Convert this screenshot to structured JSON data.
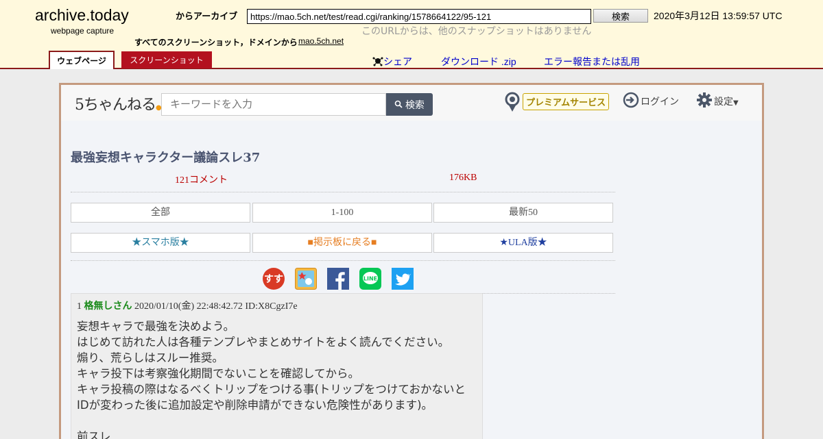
{
  "archive": {
    "brand_title": "archive.today",
    "brand_subtitle": "webpage capture",
    "archive_label": "からアーカイブ",
    "url_value": "https://mao.5ch.net/test/read.cgi/ranking/1578664122/95-121",
    "search_button": "検索",
    "capture_date": "2020年3月12日 13:59:57 UTC",
    "no_snapshots": "このURLからは、他のスナップショットはありません",
    "all_screenshots_label": "すべてのスクリーンショット，ドメインから",
    "domain_link": "mao.5ch.net",
    "tabs": [
      {
        "label": "ウェブページ",
        "active": true
      },
      {
        "label": "スクリーンショット",
        "active": false
      }
    ],
    "share_label": "シェア",
    "download_label": "ダウンロード .zip",
    "report_label": "エラー報告または乱用"
  },
  "site": {
    "logo_text": "5ちゃんねる",
    "keyword_placeholder": "キーワードを入力",
    "search_button": "検索",
    "premium_label": "プレミアムサービス",
    "login_label": "ログイン",
    "settings_label": "設定"
  },
  "thread": {
    "title": "最強妄想キャラクター議論スレ37",
    "comment_count": "121コメント",
    "size": "176KB",
    "nav_buttons": [
      "全部",
      "1-100",
      "最新50"
    ],
    "link_buttons": [
      "★スマホ版★",
      "■掲示板に戻る■",
      "★ULA版★"
    ]
  },
  "share_icons": [
    "sssp-icon",
    "bookmark-icon",
    "facebook-icon",
    "line-icon",
    "twitter-icon"
  ],
  "post": {
    "number": "1",
    "author": "格無しさん",
    "datetime": "2020/01/10(金) 22:48:42.72",
    "id": "ID:X8CgzI7e",
    "body": [
      "妄想キャラで最強を決めよう。",
      "はじめて訪れた人は各種テンプレやまとめサイトをよく読んでください。",
      "煽り、荒らしはスルー推奨。",
      "キャラ投下は考察強化期間でないことを確認してから。",
      "キャラ投稿の際はなるべくトリップをつける事(トリップをつけておかないと",
      "IDが変わった後に追加設定や削除申請ができない危険性があります)。",
      "",
      "前スレ"
    ]
  },
  "colors": {
    "archive_bg": "#fff9dd",
    "archive_accent": "#b3111f",
    "thread_title": "#4a5470",
    "author_green": "#1a8a1a"
  }
}
